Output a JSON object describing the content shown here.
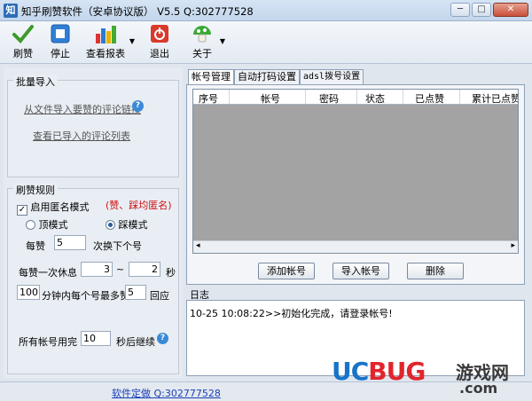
{
  "window": {
    "icon_text": "知",
    "title": "知乎刷赞软件（安卓协议版） V5.5   Q:302777528",
    "controls": {
      "minimize": "─",
      "maximize": "□",
      "close": "✕"
    }
  },
  "toolbar": {
    "like": "刷赞",
    "stop": "停止",
    "report": "查看报表",
    "exit": "退出",
    "about": "关于"
  },
  "batch_import": {
    "title": "批量导入",
    "import_link": "从文件导入要赞的评论链接",
    "view_link": "查看已导入的评论列表"
  },
  "rules": {
    "title": "刷赞规则",
    "anon_label": "启用匿名模式",
    "anon_note": "(赞、踩均匿名)",
    "mode_up": "顶模式",
    "mode_down": "踩模式",
    "per_like_label": "每赞",
    "per_like_value": "5",
    "switch_label": "次换下个号",
    "rest_label": "每赞一次休息",
    "rest_min": "3",
    "rest_dash": "~",
    "rest_max": "2",
    "rest_unit": "秒",
    "minutes_value": "100",
    "minutes_label": "分钟内每个号最多赞",
    "max_value": "5",
    "max_unit": "回应",
    "all_done_label": "所有帐号用完",
    "all_done_value": "10",
    "all_done_unit": "秒后继续"
  },
  "tabs": [
    "帐号管理",
    "自动打码设置",
    "adsl拨号设置"
  ],
  "table": {
    "columns": [
      "序号",
      "帐号",
      "密码",
      "状态",
      "已点赞",
      "累计已点赞"
    ]
  },
  "account_buttons": {
    "add": "添加帐号",
    "import": "导入帐号",
    "delete": "删除"
  },
  "log": {
    "label": "日志",
    "lines": [
      "10-25 10:08:22>>初始化完成，请登录帐号!"
    ]
  },
  "status": {
    "link": "软件定做  Q:302777528"
  },
  "watermark": {
    "brand_a": "UC",
    "brand_b": "BUG",
    "cn": "游戏网",
    "com": ".com"
  },
  "colors": {
    "accent": "#1674c9",
    "brand_red": "#e2242c",
    "stop_blue": "#2f7fd6",
    "exit_red": "#d83a2c"
  }
}
